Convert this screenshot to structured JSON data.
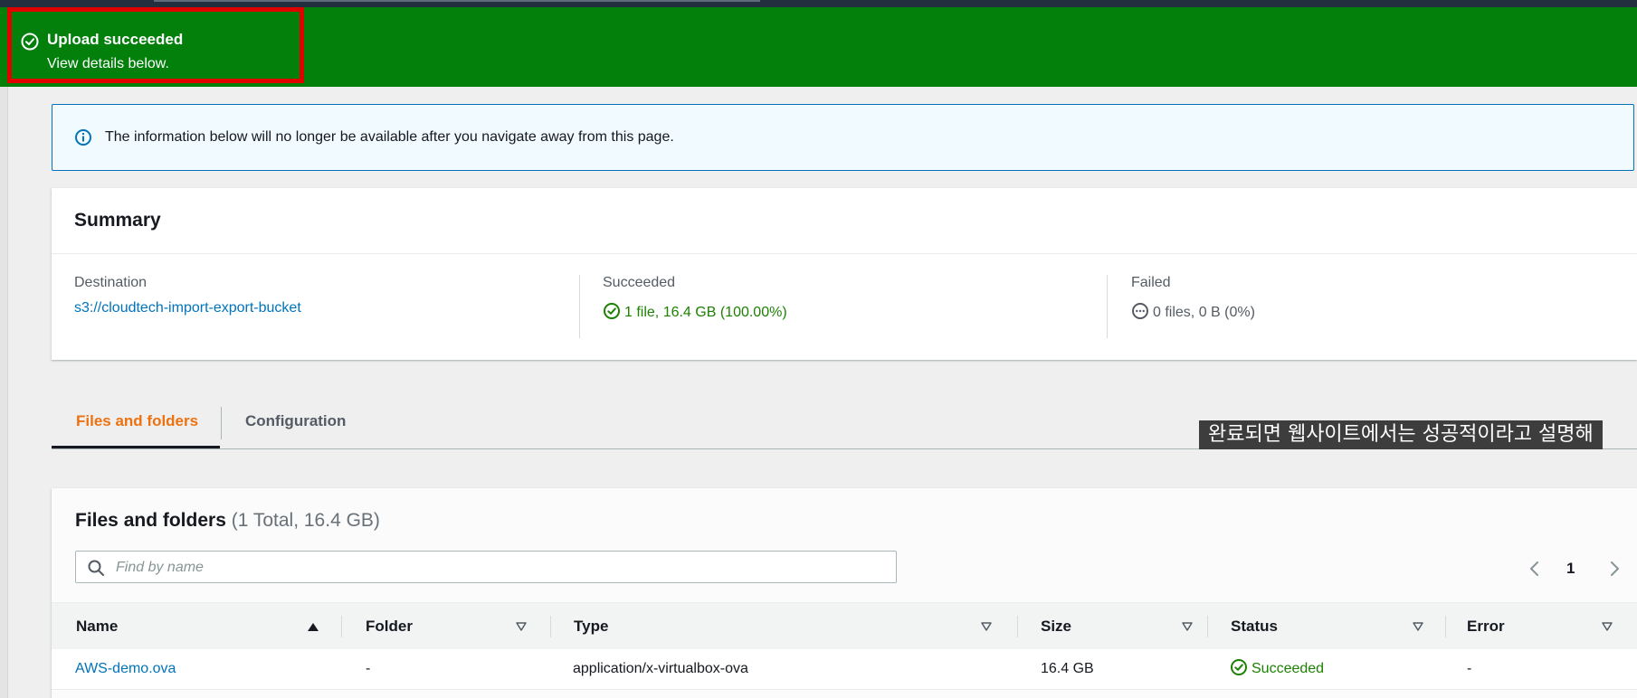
{
  "flash": {
    "title": "Upload succeeded",
    "subtitle": "View details below.",
    "color": "#037f0c",
    "icon": "check-circle-icon"
  },
  "info_alert": {
    "icon": "info-icon",
    "text": "The information below will no longer be available after you navigate away from this page."
  },
  "summary": {
    "title": "Summary",
    "destination": {
      "label": "Destination",
      "value": "s3://cloudtech-import-export-bucket"
    },
    "succeeded": {
      "label": "Succeeded",
      "value": "1 file, 16.4 GB (100.00%)",
      "icon": "check-circle-icon"
    },
    "failed": {
      "label": "Failed",
      "value": "0 files, 0 B (0%)",
      "icon": "ellipsis-circle-icon"
    }
  },
  "tabs": [
    {
      "label": "Files and folders",
      "active": true
    },
    {
      "label": "Configuration",
      "active": false
    }
  ],
  "video_subtitle": "완료되면 웹사이트에서는 성공적이라고 설명해",
  "files_table": {
    "title": "Files and folders",
    "count": "(1 Total, 16.4 GB)",
    "search_placeholder": "Find by name",
    "page": "1",
    "columns": [
      "Name",
      "Folder",
      "Type",
      "Size",
      "Status",
      "Error"
    ],
    "rows": [
      {
        "name": "AWS-demo.ova",
        "folder": "-",
        "type": "application/x-virtualbox-ova",
        "size": "16.4 GB",
        "status": "Succeeded",
        "error": "-"
      }
    ]
  },
  "colors": {
    "accent_orange": "#ec7211",
    "link_blue": "#0073bb",
    "success_green": "#1d8102",
    "highlight_red": "#e00000"
  }
}
